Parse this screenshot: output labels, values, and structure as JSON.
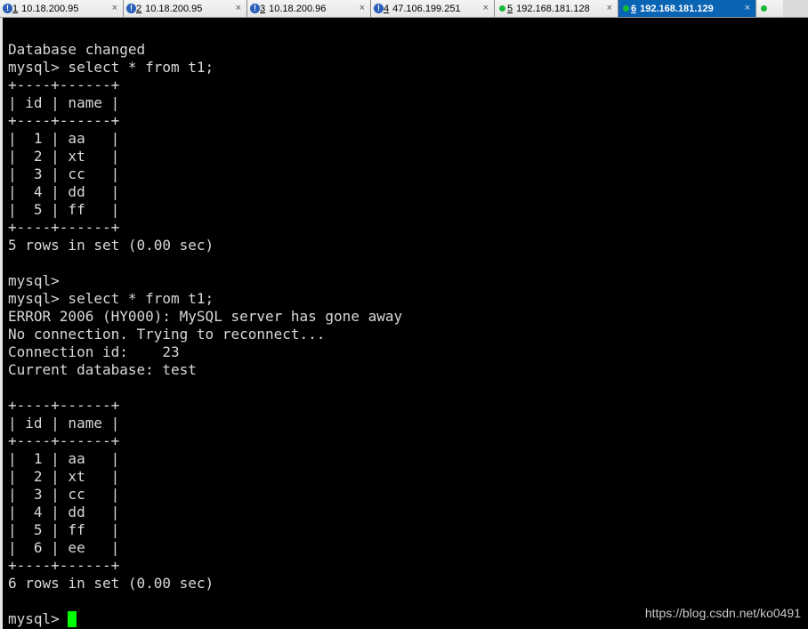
{
  "tabs": [
    {
      "num": "1",
      "host": "10.18.200.95",
      "status": "warning-icon",
      "active": false
    },
    {
      "num": "2",
      "host": "10.18.200.95",
      "status": "warning-icon",
      "active": false
    },
    {
      "num": "3",
      "host": "10.18.200.96",
      "status": "warning-icon",
      "active": false
    },
    {
      "num": "4",
      "host": "47.106.199.251",
      "status": "warning-icon",
      "active": false
    },
    {
      "num": "5",
      "host": "192.168.181.128",
      "status": "connected-dot-icon",
      "active": false
    },
    {
      "num": "6",
      "host": "192.168.181.129",
      "status": "connected-dot-icon",
      "active": true
    }
  ],
  "tab_close_glyph": "×",
  "terminal": {
    "lines": [
      "Database changed",
      "mysql> select * from t1;",
      "+----+------+",
      "| id | name |",
      "+----+------+",
      "|  1 | aa   |",
      "|  2 | xt   |",
      "|  3 | cc   |",
      "|  4 | dd   |",
      "|  5 | ff   |",
      "+----+------+",
      "5 rows in set (0.00 sec)",
      "",
      "mysql>",
      "mysql> select * from t1;",
      "ERROR 2006 (HY000): MySQL server has gone away",
      "No connection. Trying to reconnect...",
      "Connection id:    23",
      "Current database: test",
      "",
      "+----+------+",
      "| id | name |",
      "+----+------+",
      "|  1 | aa   |",
      "|  2 | xt   |",
      "|  3 | cc   |",
      "|  4 | dd   |",
      "|  5 | ff   |",
      "|  6 | ee   |",
      "+----+------+",
      "6 rows in set (0.00 sec)",
      ""
    ],
    "prompt": "mysql> "
  },
  "watermark": "https://blog.csdn.net/ko0491",
  "colors": {
    "background": "#000000",
    "text": "#d8d8d8",
    "cursor": "#00ff00",
    "active_tab": "#0a64b4",
    "connected_dot": "#16b93a",
    "warning_icon": "#2a5fb8"
  }
}
